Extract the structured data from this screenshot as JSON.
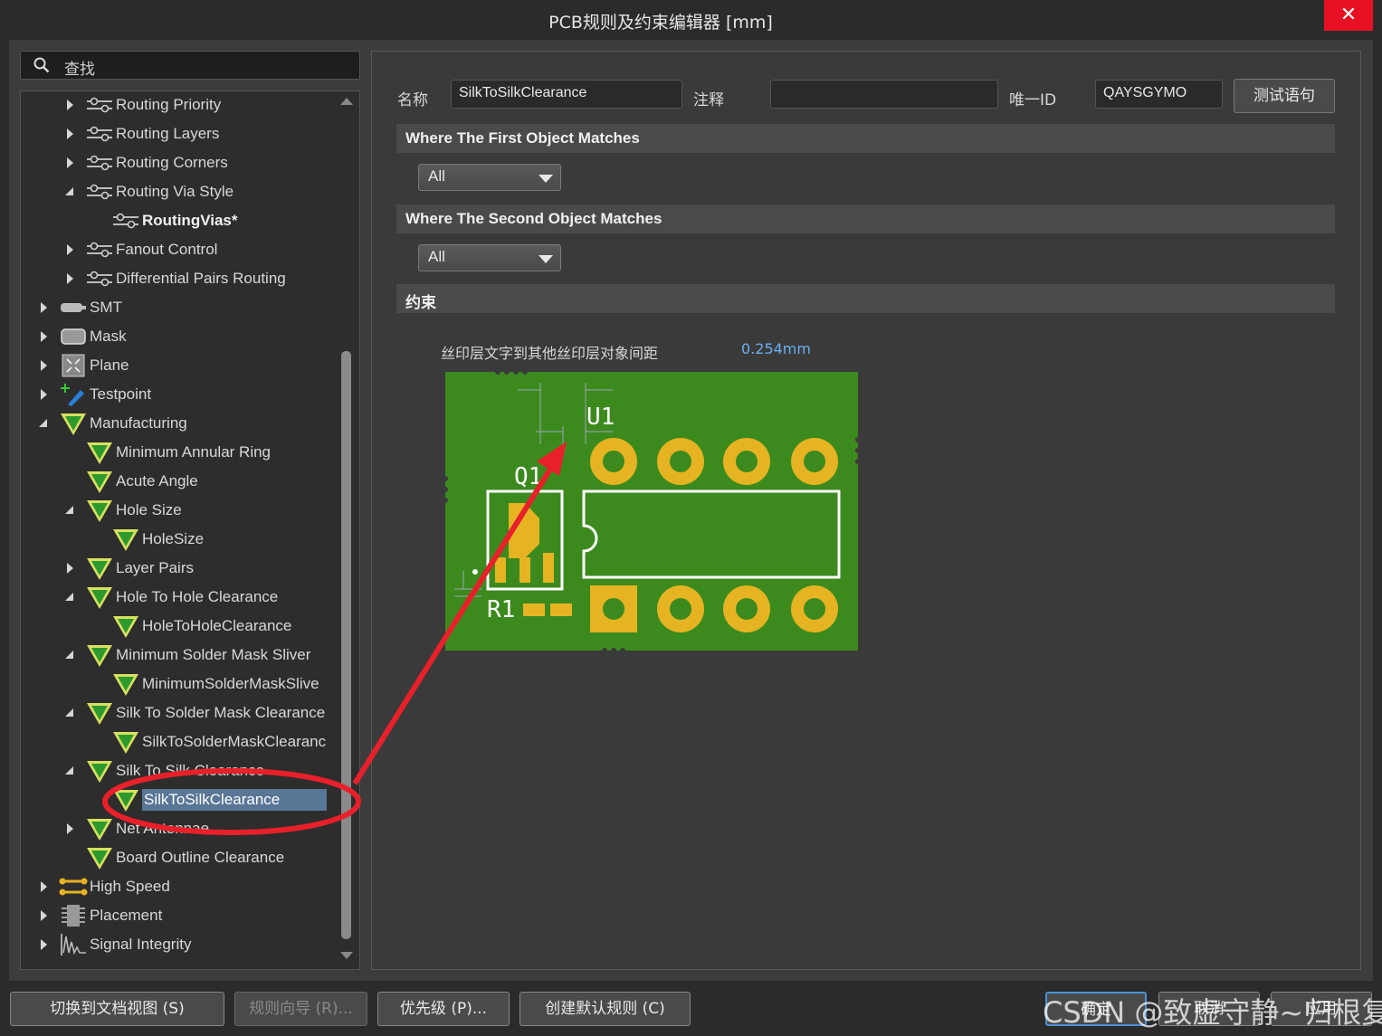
{
  "window": {
    "title": "PCB规则及约束编辑器 [mm]",
    "close": "✕"
  },
  "search": {
    "placeholder": "查找"
  },
  "tree": [
    {
      "label": "Routing Priority",
      "icon": "routing-icon",
      "depth": 2,
      "state": "collapsed"
    },
    {
      "label": "Routing Layers",
      "icon": "routing-icon",
      "depth": 2,
      "state": "collapsed"
    },
    {
      "label": "Routing Corners",
      "icon": "routing-icon",
      "depth": 2,
      "state": "collapsed"
    },
    {
      "label": "Routing Via Style",
      "icon": "routing-icon",
      "depth": 2,
      "state": "expanded"
    },
    {
      "label": "RoutingVias*",
      "icon": "routing-icon",
      "depth": 3,
      "state": "none",
      "bold": true
    },
    {
      "label": "Fanout Control",
      "icon": "routing-icon",
      "depth": 2,
      "state": "collapsed"
    },
    {
      "label": "Differential Pairs Routing",
      "icon": "routing-icon",
      "depth": 2,
      "state": "collapsed"
    },
    {
      "label": "SMT",
      "icon": "smt-icon",
      "depth": 1,
      "state": "collapsed"
    },
    {
      "label": "Mask",
      "icon": "mask-icon",
      "depth": 1,
      "state": "collapsed"
    },
    {
      "label": "Plane",
      "icon": "plane-icon",
      "depth": 1,
      "state": "collapsed"
    },
    {
      "label": "Testpoint",
      "icon": "testpoint-icon",
      "depth": 1,
      "state": "collapsed"
    },
    {
      "label": "Manufacturing",
      "icon": "manufacturing-icon",
      "depth": 1,
      "state": "expanded"
    },
    {
      "label": "Minimum Annular Ring",
      "icon": "manufacturing-icon",
      "depth": 2,
      "state": "none"
    },
    {
      "label": "Acute Angle",
      "icon": "manufacturing-icon",
      "depth": 2,
      "state": "none"
    },
    {
      "label": "Hole Size",
      "icon": "manufacturing-icon",
      "depth": 2,
      "state": "expanded"
    },
    {
      "label": "HoleSize",
      "icon": "manufacturing-icon",
      "depth": 3,
      "state": "none"
    },
    {
      "label": "Layer Pairs",
      "icon": "manufacturing-icon",
      "depth": 2,
      "state": "collapsed"
    },
    {
      "label": "Hole To Hole Clearance",
      "icon": "manufacturing-icon",
      "depth": 2,
      "state": "expanded"
    },
    {
      "label": "HoleToHoleClearance",
      "icon": "manufacturing-icon",
      "depth": 3,
      "state": "none"
    },
    {
      "label": "Minimum Solder Mask Sliver",
      "icon": "manufacturing-icon",
      "depth": 2,
      "state": "expanded"
    },
    {
      "label": "MinimumSolderMaskSlive",
      "icon": "manufacturing-icon",
      "depth": 3,
      "state": "none"
    },
    {
      "label": "Silk To Solder Mask Clearance",
      "icon": "manufacturing-icon",
      "depth": 2,
      "state": "expanded"
    },
    {
      "label": "SilkToSolderMaskClearanc",
      "icon": "manufacturing-icon",
      "depth": 3,
      "state": "none"
    },
    {
      "label": "Silk To Silk Clearance",
      "icon": "manufacturing-icon",
      "depth": 2,
      "state": "expanded"
    },
    {
      "label": "SilkToSilkClearance",
      "icon": "manufacturing-icon",
      "depth": 3,
      "state": "none",
      "selected": true
    },
    {
      "label": "Net Antennae",
      "icon": "manufacturing-icon",
      "depth": 2,
      "state": "collapsed"
    },
    {
      "label": "Board Outline Clearance",
      "icon": "manufacturing-icon",
      "depth": 2,
      "state": "none"
    },
    {
      "label": "High Speed",
      "icon": "highspeed-icon",
      "depth": 1,
      "state": "collapsed"
    },
    {
      "label": "Placement",
      "icon": "placement-icon",
      "depth": 1,
      "state": "collapsed"
    },
    {
      "label": "Signal Integrity",
      "icon": "signal-icon",
      "depth": 1,
      "state": "collapsed"
    }
  ],
  "rule": {
    "name_label": "名称",
    "name_value": "SilkToSilkClearance",
    "comment_label": "注释",
    "comment_value": "",
    "uid_label": "唯一ID",
    "uid_value": "QAYSGYMO",
    "test_button": "测试语句"
  },
  "first_match": {
    "header": "Where The First Object Matches",
    "value": "All"
  },
  "second_match": {
    "header": "Where The Second Object Matches",
    "value": "All"
  },
  "constraints": {
    "header": "约束",
    "label": "丝印层文字到其他丝印层对象间距",
    "value": "0.254mm"
  },
  "pcb_preview": {
    "labels": [
      "U1",
      "Q1",
      "R1"
    ]
  },
  "buttons": {
    "doc_view": "切换到文档视图 (S)",
    "wizard": "规则向导 (R)...",
    "priority": "优先级 (P)...",
    "create_default": "创建默认规则 (C)",
    "ok": "确定",
    "cancel": "取消",
    "apply": "应用"
  },
  "watermark": "CSDN @致虚守静~归根复命",
  "colors": {
    "pcb_green": "#3c8a1e",
    "pad_gold": "#e6b422",
    "selection": "#5a7696",
    "annotation_red": "#e8202a"
  }
}
